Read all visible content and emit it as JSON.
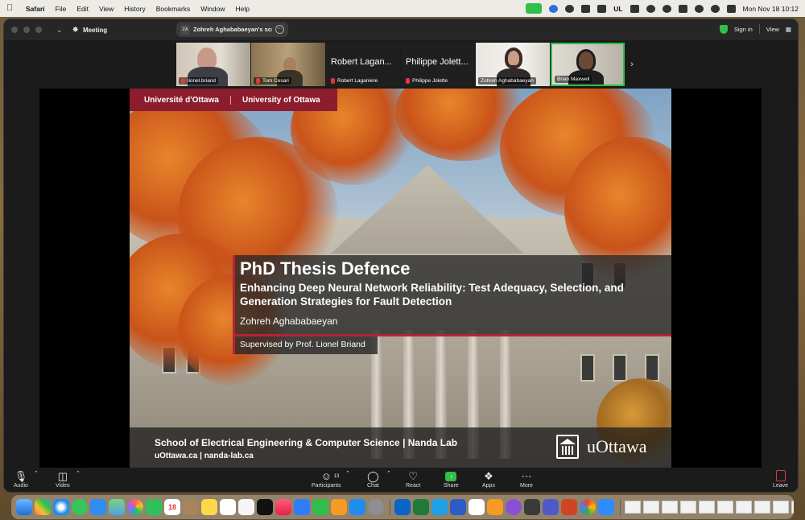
{
  "menubar": {
    "app_name": "Safari",
    "menus": [
      "File",
      "Edit",
      "View",
      "History",
      "Bookmarks",
      "Window",
      "Help"
    ],
    "tray_text": "UL",
    "datetime": "Mon Nov 18  10:12"
  },
  "window": {
    "title": "Meeting",
    "share_indicator": {
      "initials": "ZA",
      "label": "Zohreh Aghababaeyan's screen"
    },
    "sign_in_label": "Sign in",
    "view_label": "View"
  },
  "participants": [
    {
      "name": "lionel.briand",
      "muted": true,
      "video": true
    },
    {
      "name": "Tom Cesari",
      "muted": true,
      "video": true
    },
    {
      "name": "Robert Laganiere",
      "display": "Robert Lagan...",
      "muted": true,
      "video": false
    },
    {
      "name": "Philippe Jolette",
      "display": "Philippe Jolett...",
      "muted": true,
      "video": false
    },
    {
      "name": "Zohreh Aghababaeyan",
      "muted": false,
      "video": true
    },
    {
      "name": "Brian Maxwell",
      "muted": false,
      "video": true,
      "active": true
    }
  ],
  "slide": {
    "header_fr": "Université d'Ottawa",
    "header_en": "University of Ottawa",
    "title": "PhD Thesis Defence",
    "subtitle": "Enhancing Deep Neural Network Reliability: Test Adequacy, Selection, and Generation Strategies for Fault Detection",
    "author": "Zohreh Aghababaeyan",
    "supervisor": "Supervised by Prof. Lionel Briand",
    "school": "School of Electrical Engineering & Computer Science | Nanda Lab",
    "urls": "uOttawa.ca | nanda-lab.ca",
    "logo_text": "uOttawa"
  },
  "toolbar": {
    "audio": "Audio",
    "video": "Video",
    "participants": "Participants",
    "participants_count": "13",
    "chat": "Chat",
    "react": "React",
    "share": "Share",
    "apps": "Apps",
    "more": "More",
    "leave": "Leave"
  },
  "dock": {
    "calendar_day": "18"
  },
  "colors": {
    "uottawa_red": "#8c1d2c",
    "accent_red": "#b42434",
    "zoom_green": "#2fbf4a",
    "muted_red": "#e0393e"
  }
}
